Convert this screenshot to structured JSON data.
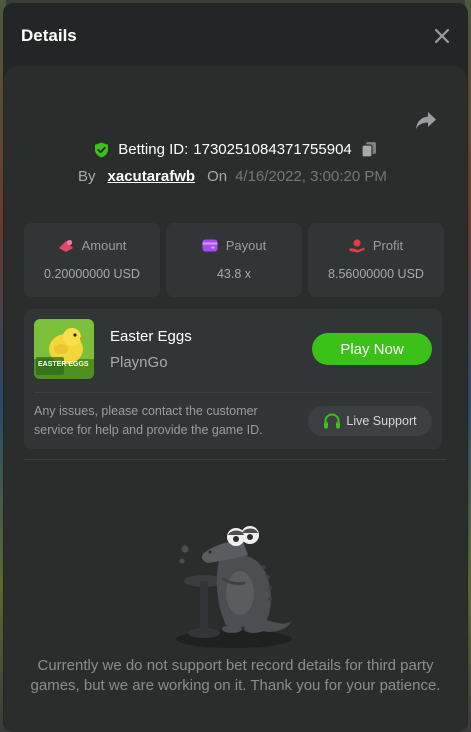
{
  "modal": {
    "title": "Details"
  },
  "bet": {
    "id_label": "Betting ID:",
    "id_value": "1730251084371755904",
    "by_label": "By",
    "username": "xacutarafwb",
    "on_label": "On",
    "date": "4/16/2022, 3:00:20 PM"
  },
  "stats": [
    {
      "label": "Amount",
      "value": "0.20000000 USD",
      "icon": "bet-amount-icon",
      "color": "#e5436b"
    },
    {
      "label": "Payout",
      "value": "43.8 x",
      "icon": "wallet-icon",
      "color": "#a64bf4"
    },
    {
      "label": "Profit",
      "value": "8.56000000 USD",
      "icon": "profit-icon",
      "color": "#e24040"
    }
  ],
  "game": {
    "name": "Easter Eggs",
    "provider": "PlaynGo",
    "play_label": "Play Now",
    "thumb_text": "EASTER EGGS"
  },
  "support": {
    "text": "Any issues, please contact the customer service for help and provide the game ID.",
    "button_label": "Live Support"
  },
  "empty": {
    "message": "Currently we do not support bet record details for third party games, but we are working on it. Thank you for your patience."
  },
  "colors": {
    "accent_green": "#3bc117",
    "modal_bg": "#232626",
    "panel_bg": "#2b2d2d",
    "card_bg": "#323536"
  }
}
